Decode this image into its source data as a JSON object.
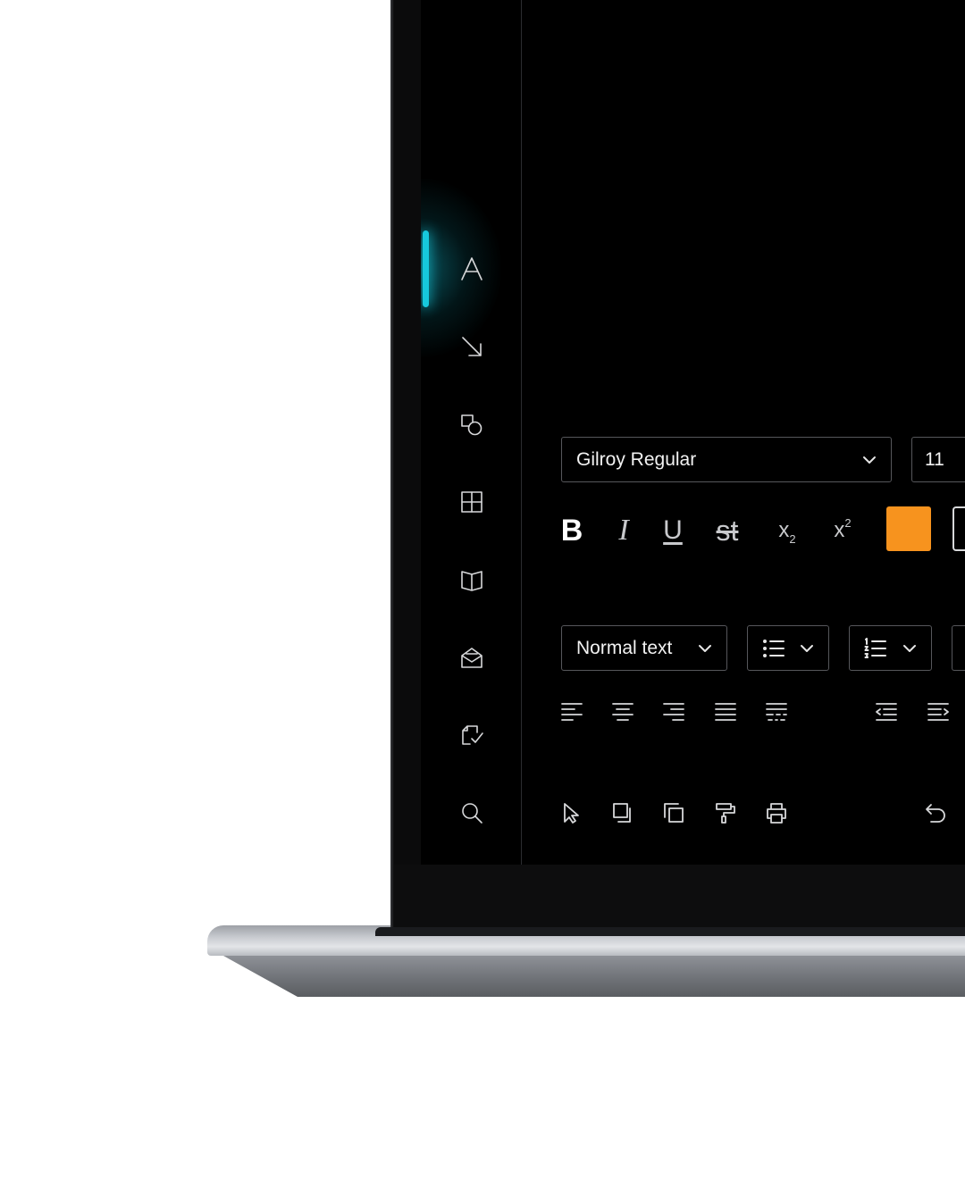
{
  "sidebar": {
    "items": [
      {
        "icon": "text-icon",
        "active": true
      },
      {
        "icon": "arrow-down-right-icon"
      },
      {
        "icon": "shapes-icon"
      },
      {
        "icon": "table-icon"
      },
      {
        "icon": "book-icon"
      },
      {
        "icon": "open-envelope-icon"
      },
      {
        "icon": "document-check-icon"
      },
      {
        "icon": "search-icon"
      }
    ]
  },
  "text_panel": {
    "font_family": "Gilroy Regular",
    "font_size": "11",
    "format": {
      "bold": "B",
      "italic": "I",
      "underline": "U",
      "strikethrough": "st",
      "subscript_base": "x",
      "subscript_mark": "2",
      "superscript_base": "x",
      "superscript_mark": "2"
    },
    "text_color": "#F7931E",
    "paragraph_style": "Normal text"
  },
  "colors": {
    "accent": "#16C8DC",
    "screen_background": "#000000",
    "swatch": "#F7931E"
  }
}
